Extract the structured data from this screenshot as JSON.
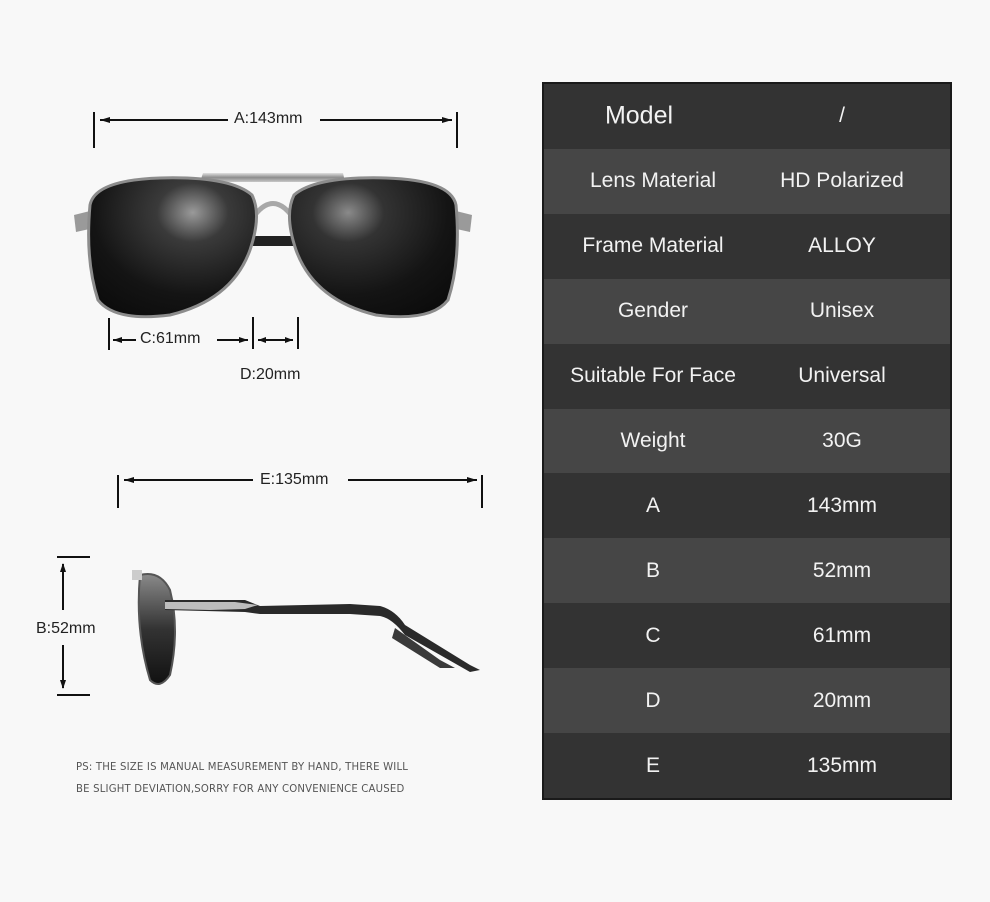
{
  "dimensions_front": {
    "a_label": "A:143mm",
    "c_label": "C:61mm",
    "d_label": "D:20mm"
  },
  "dimensions_side": {
    "e_label": "E:135mm",
    "b_label": "B:52mm"
  },
  "note": {
    "line1": "PS: THE SIZE IS MANUAL MEASUREMENT BY HAND, THERE WILL",
    "line2": "BE SLIGHT DEVIATION,SORRY FOR ANY CONVENIENCE CAUSED"
  },
  "spec_table": {
    "rows": [
      {
        "key": "Model",
        "value": "/"
      },
      {
        "key": "Lens Material",
        "value": "HD Polarized"
      },
      {
        "key": "Frame Material",
        "value": "ALLOY"
      },
      {
        "key": "Gender",
        "value": "Unisex"
      },
      {
        "key": "Suitable For Face",
        "value": "Universal"
      },
      {
        "key": "Weight",
        "value": "30G"
      },
      {
        "key": "A",
        "value": "143mm"
      },
      {
        "key": "B",
        "value": "52mm"
      },
      {
        "key": "C",
        "value": "61mm"
      },
      {
        "key": "D",
        "value": "20mm"
      },
      {
        "key": "E",
        "value": "135mm"
      }
    ]
  }
}
